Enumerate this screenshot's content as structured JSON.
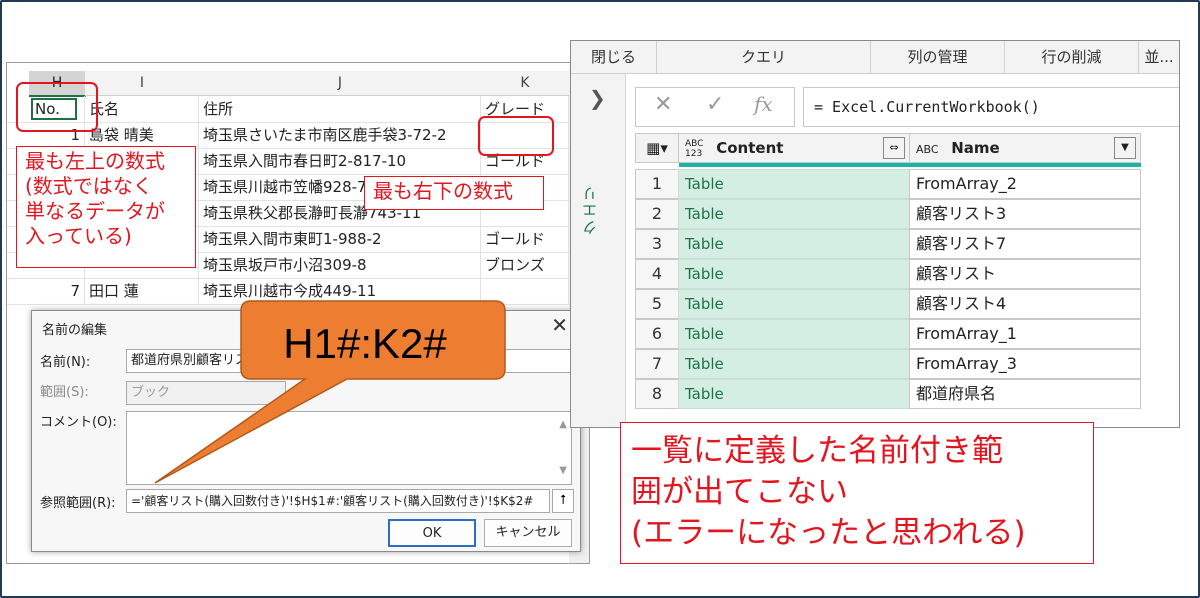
{
  "excel": {
    "columns": [
      "H",
      "I",
      "J",
      "K"
    ],
    "header_row": {
      "no": "No.",
      "name": "氏名",
      "address": "住所",
      "grade": "グレード"
    },
    "rows": [
      {
        "no": "1",
        "name": "島袋 晴美",
        "address": "埼玉県さいたま市南区鹿手袋3-72-2",
        "grade": ""
      },
      {
        "no": "",
        "name": "",
        "address": "埼玉県入間市春日町2-817-10",
        "grade": "ゴールド"
      },
      {
        "no": "",
        "name": "",
        "address": "埼玉県川越市笠幡928-7",
        "grade": ""
      },
      {
        "no": "",
        "name": "",
        "address": "埼玉県秩父郡長瀞町長瀞743-11",
        "grade": ""
      },
      {
        "no": "",
        "name": "",
        "address": "埼玉県入間市東町1-988-2",
        "grade": "ゴールド"
      },
      {
        "no": "",
        "name": "",
        "address": "埼玉県坂戸市小沼309-8",
        "grade": "ブロンズ"
      },
      {
        "no": "7",
        "name": "田口 蓮",
        "address": "埼玉県川越市今成449-11",
        "grade": ""
      }
    ]
  },
  "dialog": {
    "title": "名前の編集",
    "close": "✕",
    "name_label": "名前(N):",
    "name_value": "都道府県別顧客リス",
    "scope_label": "範囲(S):",
    "scope_value": "ブック",
    "comment_label": "コメント(O):",
    "ref_label": "参照範囲(R):",
    "ref_value": "='顧客リスト(購入回数付き)'!$H$1#:'顧客リスト(購入回数付き)'!$K$2#",
    "ok": "OK",
    "cancel": "キャンセル"
  },
  "annotations": {
    "top_left_note": "最も左上の数式\n(数式ではなく\n単なるデータが\n入っている)",
    "bottom_right_note": "最も右下の数式",
    "callout": "H1#:K2#",
    "pq_note": "一覧に定義した名前付き範\n囲が出てこない\n(エラーになったと思われる)"
  },
  "power_query": {
    "tabs": [
      "閉じる",
      "クエリ",
      "列の管理",
      "行の削減",
      "並..."
    ],
    "left_pane_label": "クエリ",
    "formula": "= Excel.CurrentWorkbook()",
    "columns": [
      {
        "type_icon": "ABC 123",
        "label": "Content"
      },
      {
        "type_icon": "ABC",
        "label": "Name"
      }
    ],
    "rows": [
      {
        "n": "1",
        "content": "Table",
        "name": "FromArray_2"
      },
      {
        "n": "2",
        "content": "Table",
        "name": "顧客リスト3"
      },
      {
        "n": "3",
        "content": "Table",
        "name": "顧客リスト7"
      },
      {
        "n": "4",
        "content": "Table",
        "name": "顧客リスト"
      },
      {
        "n": "5",
        "content": "Table",
        "name": "顧客リスト4"
      },
      {
        "n": "6",
        "content": "Table",
        "name": "FromArray_1"
      },
      {
        "n": "7",
        "content": "Table",
        "name": "FromArray_3"
      },
      {
        "n": "8",
        "content": "Table",
        "name": "都道府県名"
      }
    ]
  },
  "colors": {
    "accent_red": "#e3161f",
    "callout_orange": "#ed7d31",
    "excel_green": "#1e7145",
    "pq_teal": "#1ab3a6"
  }
}
